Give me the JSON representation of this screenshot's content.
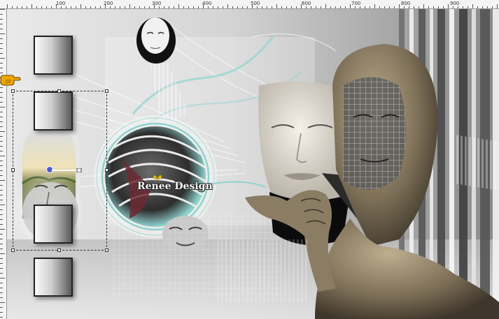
{
  "ruler": {
    "ticks": [
      "100",
      "200",
      "300",
      "400",
      "500",
      "600",
      "700",
      "800",
      "900"
    ]
  },
  "canvas": {
    "watermark": "Renee Design"
  },
  "icons": {
    "pointer": "pointing-hand-icon",
    "watermark_mark": "butterfly-icon",
    "rotate": "rotate-handle-icon"
  },
  "colors": {
    "rotate_handle": "#4b5bd6",
    "watermark_butterfly": "#e6c200",
    "pointer": "#f0a500"
  }
}
